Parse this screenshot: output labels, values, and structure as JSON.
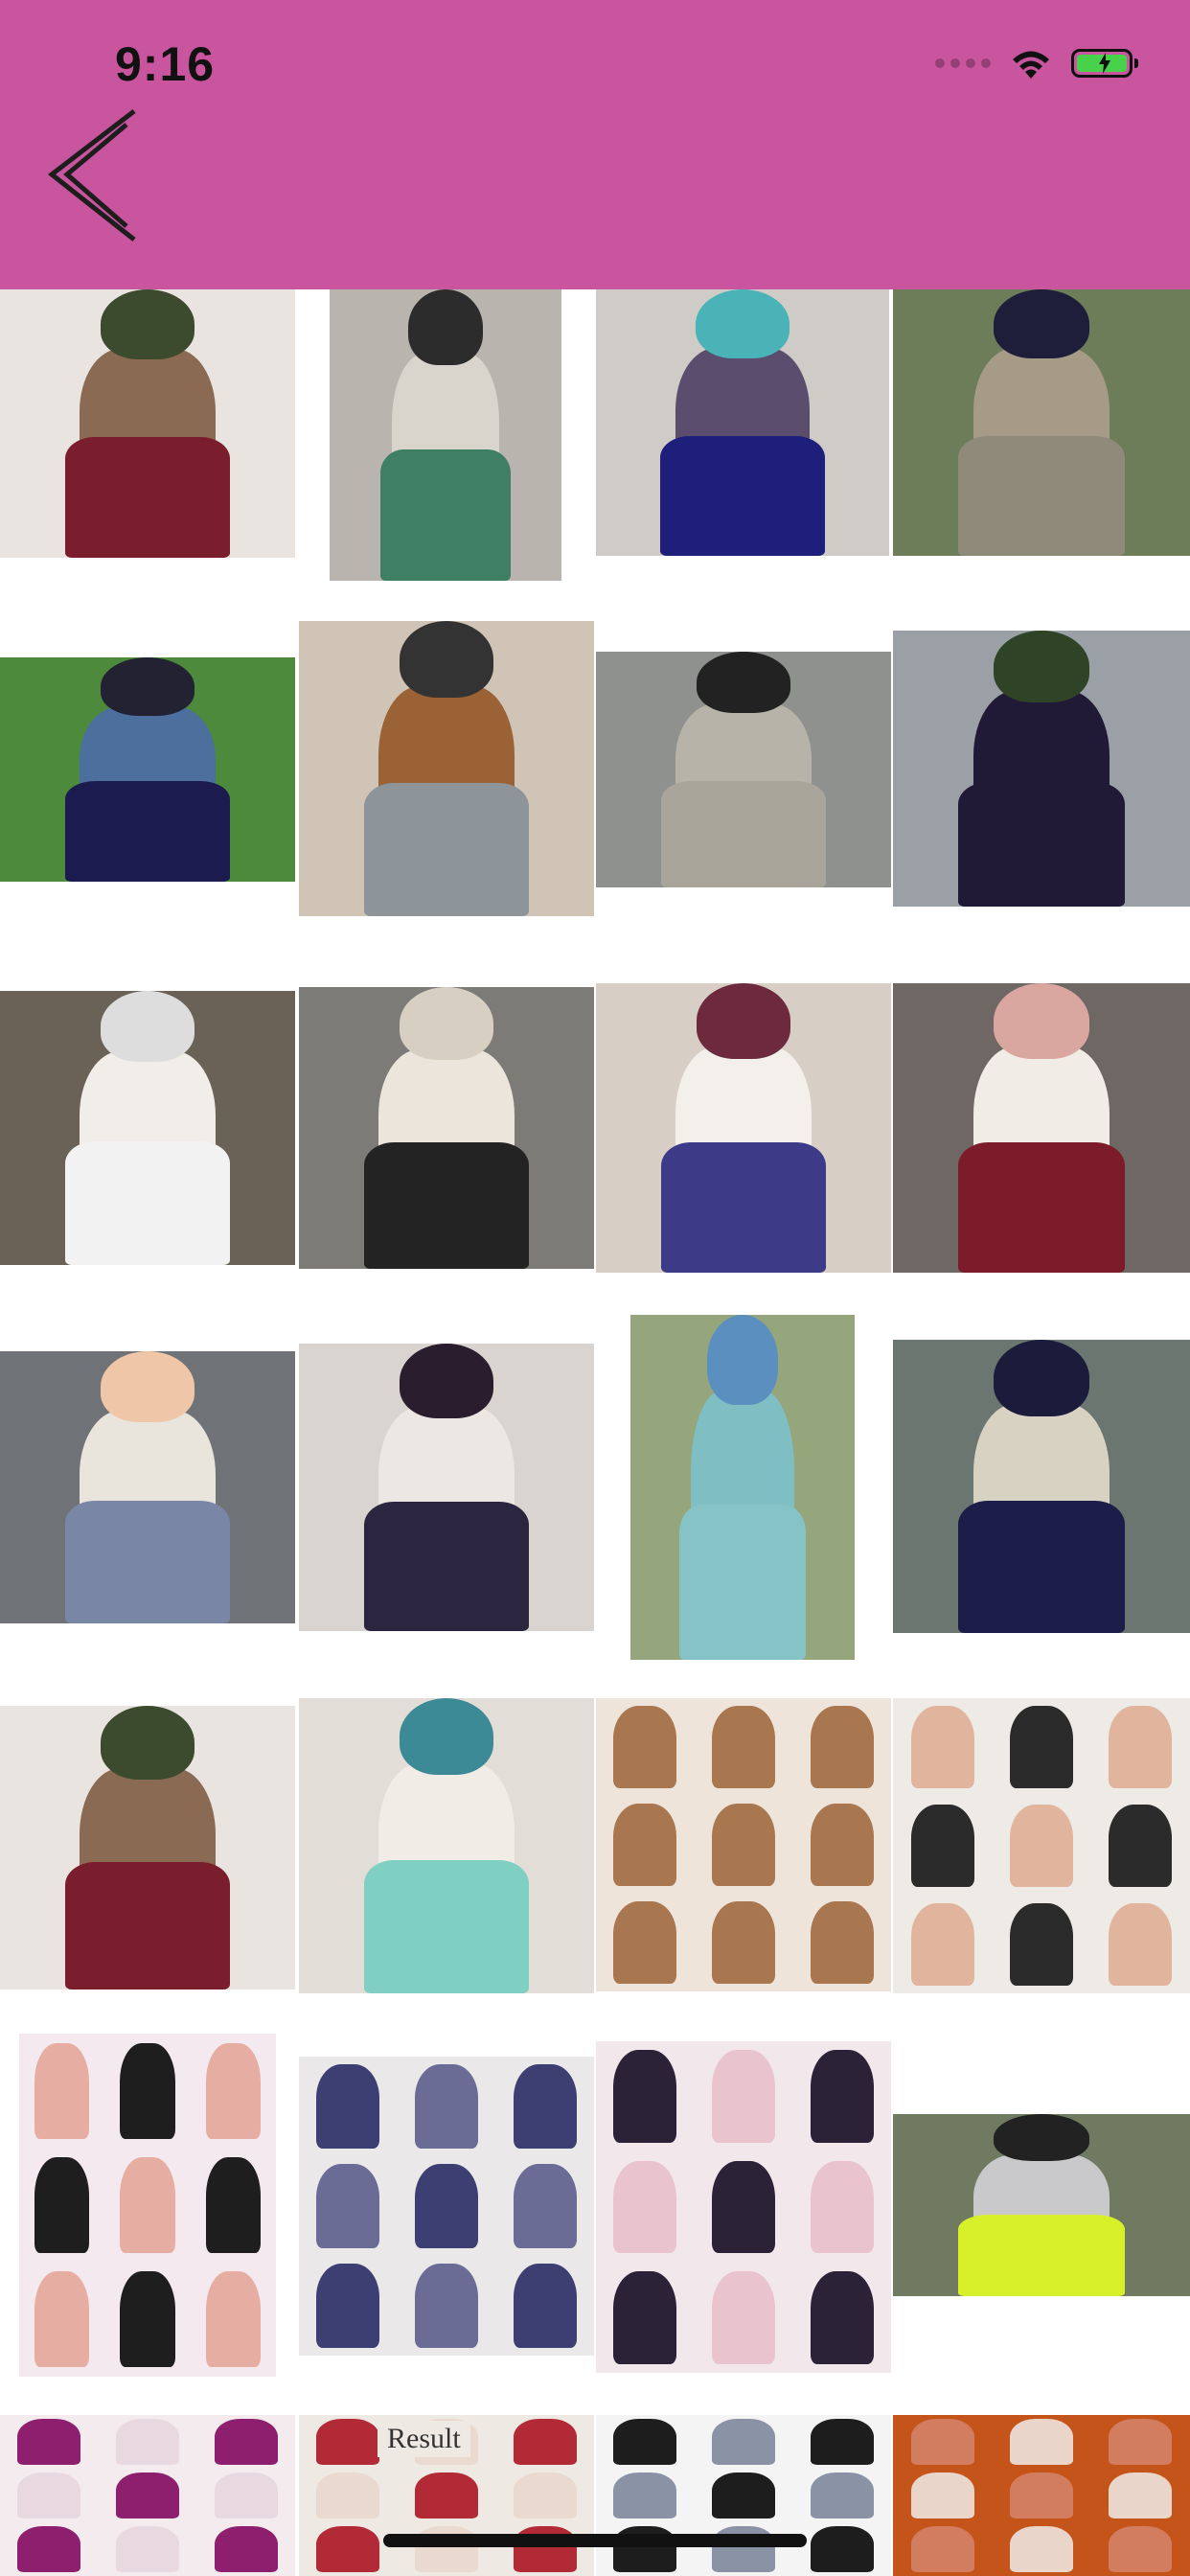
{
  "status_bar": {
    "time": "9:16"
  },
  "icons": {
    "back": "back-chevron-icon",
    "wifi": "wifi-icon",
    "battery": "battery-charging-icon",
    "signal": "cellular-signal-icon"
  },
  "colors": {
    "header": "#c9559f",
    "battery": "#48d14a",
    "background": "#ffffff"
  },
  "grid": {
    "columns": 4,
    "items": [
      {
        "name": "outfit-photo-1",
        "bg": "#e9e4df",
        "hijab": "#3c4a2e",
        "top": "#8a6a52",
        "skirt": "#7a1d2c"
      },
      {
        "name": "outfit-photo-2",
        "bg": "#b9b4ad",
        "hijab": "#2c2c2c",
        "top": "#d9d4cc",
        "skirt": "#3f8064"
      },
      {
        "name": "outfit-photo-3",
        "bg": "#cfcbc6",
        "hijab": "#4ab3b7",
        "top": "#5a4d6e",
        "skirt": "#1e1f7a"
      },
      {
        "name": "outfit-photo-4",
        "bg": "#6d7d5a",
        "hijab": "#1e1e3a",
        "top": "#a59b86",
        "skirt": "#8f8a7a"
      },
      {
        "name": "outfit-photo-5",
        "bg": "#4e8a3c",
        "hijab": "#222233",
        "top": "#4c6f9e",
        "skirt": "#1b1b4f"
      },
      {
        "name": "outfit-photo-6",
        "bg": "#cfc4b6",
        "hijab": "#333333",
        "top": "#9a6235",
        "skirt": "#8d949a"
      },
      {
        "name": "outfit-photo-7",
        "bg": "#8f918f",
        "hijab": "#222222",
        "top": "#b8b3a8",
        "skirt": "#aaa59b"
      },
      {
        "name": "outfit-photo-8",
        "bg": "#9aa0a6",
        "hijab": "#2f4426",
        "top": "#201a36",
        "skirt": "#201a36"
      },
      {
        "name": "outfit-photo-9",
        "bg": "#6b6257",
        "hijab": "#dddddd",
        "top": "#f1ede8",
        "skirt": "#f2f2f2"
      },
      {
        "name": "outfit-photo-10",
        "bg": "#7d7b78",
        "hijab": "#d8cfc3",
        "top": "#ebe5dc",
        "skirt": "#232323"
      },
      {
        "name": "outfit-photo-11",
        "bg": "#d7cfc6",
        "hijab": "#6d2a3e",
        "top": "#f3f0ec",
        "skirt": "#3d3b88"
      },
      {
        "name": "outfit-photo-12",
        "bg": "#6e6763",
        "hijab": "#d9a7a0",
        "top": "#f1ede6",
        "skirt": "#7c1c2b"
      },
      {
        "name": "outfit-photo-13",
        "bg": "#6f7377",
        "hijab": "#f0c6a8",
        "top": "#e9e4dc",
        "skirt": "#7a86a6"
      },
      {
        "name": "outfit-photo-14",
        "bg": "#d9d4cf",
        "hijab": "#2a1d2e",
        "top": "#ece7e2",
        "skirt": "#2b2540"
      },
      {
        "name": "outfit-photo-15",
        "bg": "#95a67d",
        "hijab": "#5a8fc0",
        "top": "#7fbfc3",
        "skirt": "#86c3c6"
      },
      {
        "name": "outfit-photo-16",
        "bg": "#6b7670",
        "hijab": "#1b1b3b",
        "top": "#d8d2c3",
        "skirt": "#1d1d4a"
      },
      {
        "name": "outfit-photo-17",
        "bg": "#e9e4df",
        "hijab": "#3c4a2e",
        "top": "#8a6a52",
        "skirt": "#7a1d2c"
      },
      {
        "name": "outfit-photo-18",
        "bg": "#e3ddd7",
        "hijab": "#3b8a96",
        "top": "#f1ede6",
        "skirt": "#7fcfc2"
      },
      {
        "name": "tutorial-collage-1",
        "bg": "#efe4d9",
        "hijab": "#a8764f",
        "top": "#a8764f",
        "skirt": "#e8d2bd"
      },
      {
        "name": "tutorial-collage-2",
        "bg": "#eeeae5",
        "hijab": "#e1b49e",
        "top": "#2b2b2b",
        "skirt": "#e1b49e"
      },
      {
        "name": "tutorial-collage-3",
        "bg": "#f3e9ee",
        "hijab": "#e6aea3",
        "top": "#1e1e1e",
        "skirt": "#f4f4f4"
      },
      {
        "name": "tutorial-collage-4",
        "bg": "#ebe8ea",
        "hijab": "#3d3f72",
        "top": "#6a6c96",
        "skirt": "#1e1e2a"
      },
      {
        "name": "tutorial-collage-5",
        "bg": "#f2e8ec",
        "hijab": "#2b2238",
        "top": "#e9c4cf",
        "skirt": "#2b2238"
      },
      {
        "name": "outfit-photo-24",
        "bg": "#6f7a60",
        "hijab": "#222222",
        "top": "#c9c9cc",
        "skirt": "#d7f02a"
      },
      {
        "name": "tutorial-collage-6",
        "bg": "#f3ebee",
        "hijab": "#8d1f6e",
        "top": "#e8d8e0",
        "skirt": "#8d1f6e"
      },
      {
        "name": "tutorial-result",
        "bg": "#efe9e4",
        "hijab": "#b22a35",
        "top": "#e9d9cf",
        "skirt": "#f4f4f4"
      },
      {
        "name": "tutorial-collage-7",
        "bg": "#f4f4f4",
        "hijab": "#1d1d1d",
        "top": "#8a93a6",
        "skirt": "#f4f4f4"
      },
      {
        "name": "tutorial-collage-8",
        "bg": "#c4541a",
        "hijab": "#d27d5f",
        "top": "#e9d5c9",
        "skirt": "#2a2a2a"
      }
    ]
  },
  "result_label": "Result"
}
